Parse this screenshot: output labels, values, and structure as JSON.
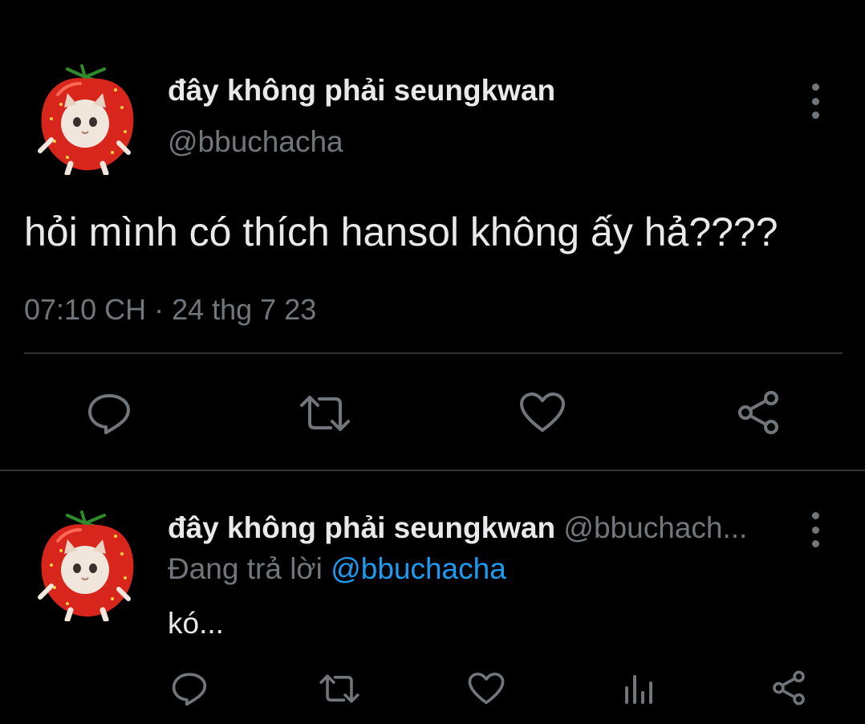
{
  "tweet": {
    "display_name": "đây không phải seungkwan",
    "handle": "@bbuchacha",
    "text": "hỏi mình có thích hansol không ấy hả????",
    "time": "07:10 CH · 24 thg 7 23",
    "avatar_icon": "strawberry-cat-avatar",
    "actions": [
      "reply-icon",
      "retweet-icon",
      "like-icon",
      "share-icon"
    ]
  },
  "reply": {
    "display_name": "đây không phải seungkwan",
    "handle": "@bbuchach...",
    "replying_prefix": "Đang trả lời ",
    "replying_mention": "@bbuchacha",
    "text": "kó...",
    "avatar_icon": "strawberry-cat-avatar",
    "actions": [
      "reply-icon",
      "retweet-icon",
      "like-icon",
      "views-icon",
      "share-icon"
    ]
  },
  "colors": {
    "background": "#000000",
    "text_primary": "#e7e9ea",
    "text_secondary": "#71767b",
    "mention": "#1d9bf0",
    "divider": "#2f3336"
  }
}
